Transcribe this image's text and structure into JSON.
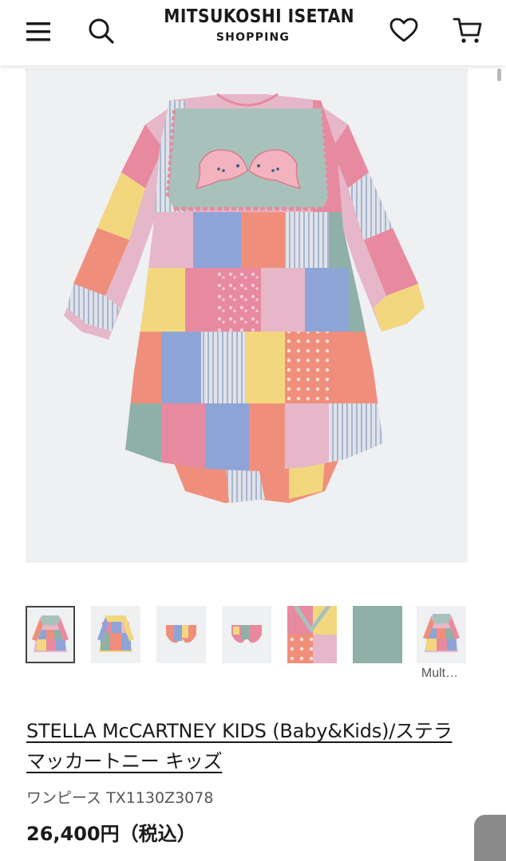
{
  "header": {
    "brand_title": "MITSUKOSHI ISETAN",
    "brand_subtitle": "SHOPPING",
    "icons": [
      "menu-icon",
      "search-icon",
      "heart-icon",
      "cart-icon"
    ]
  },
  "gallery": {
    "thumbnails": [
      {
        "name": "thumb-front",
        "selected": true
      },
      {
        "name": "thumb-back",
        "selected": false
      },
      {
        "name": "thumb-bloomers-front",
        "selected": false
      },
      {
        "name": "thumb-bloomers-back",
        "selected": false
      },
      {
        "name": "thumb-fabric-detail",
        "selected": false
      },
      {
        "name": "thumb-color-swatch",
        "selected": false
      },
      {
        "name": "thumb-multi",
        "selected": false
      }
    ],
    "last_caption": "Mult…"
  },
  "product": {
    "brand": "STELLA McCARTNEY KIDS (Baby&Kids)/ステラ マッカートニー キッズ",
    "type_code": "ワンピース TX1130Z3078",
    "price": "26,400円（税込）"
  },
  "colors": {
    "image_bg": "#eff0f2",
    "patch_pink": "#e78aa0",
    "patch_coral": "#ef8f7b",
    "patch_yellow": "#f3d77e",
    "patch_blue": "#8fa4d6",
    "patch_green": "#8fb0a6",
    "patch_lilac": "#e6b7c8"
  }
}
